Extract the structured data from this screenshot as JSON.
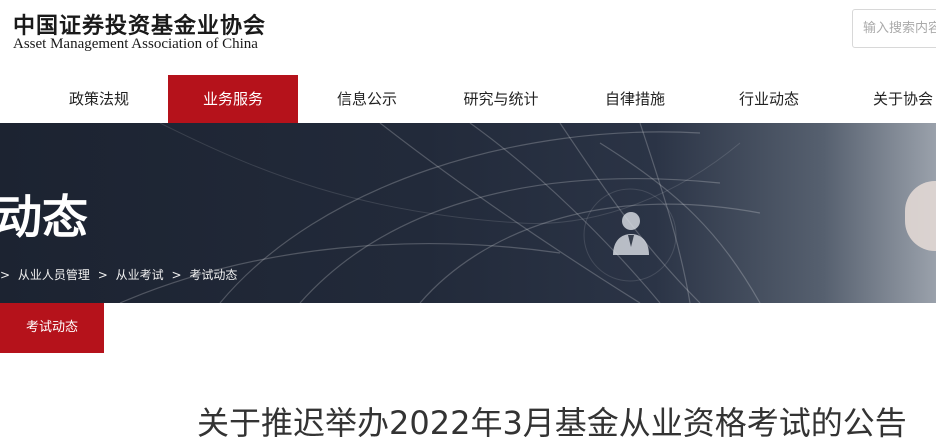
{
  "header": {
    "logo_cn": "中国证券投资基金业协会",
    "logo_en": "Asset Management Association of China",
    "search_placeholder": "输入搜索内容"
  },
  "nav": {
    "items": [
      {
        "label": "政策法规",
        "active": false
      },
      {
        "label": "业务服务",
        "active": true
      },
      {
        "label": "信息公示",
        "active": false
      },
      {
        "label": "研究与统计",
        "active": false
      },
      {
        "label": "自律措施",
        "active": false
      },
      {
        "label": "行业动态",
        "active": false
      },
      {
        "label": "关于协会",
        "active": false
      }
    ]
  },
  "banner": {
    "title": "动态",
    "breadcrumb": [
      ">",
      "从业人员管理",
      ">",
      "从业考试",
      ">",
      "考试动态"
    ]
  },
  "sub_nav": {
    "active_label": "考试动态"
  },
  "article": {
    "title": "关于推迟举办2022年3月基金从业资格考试的公告"
  },
  "colors": {
    "accent": "#b5121b",
    "banner_dark": "#1c2331"
  }
}
